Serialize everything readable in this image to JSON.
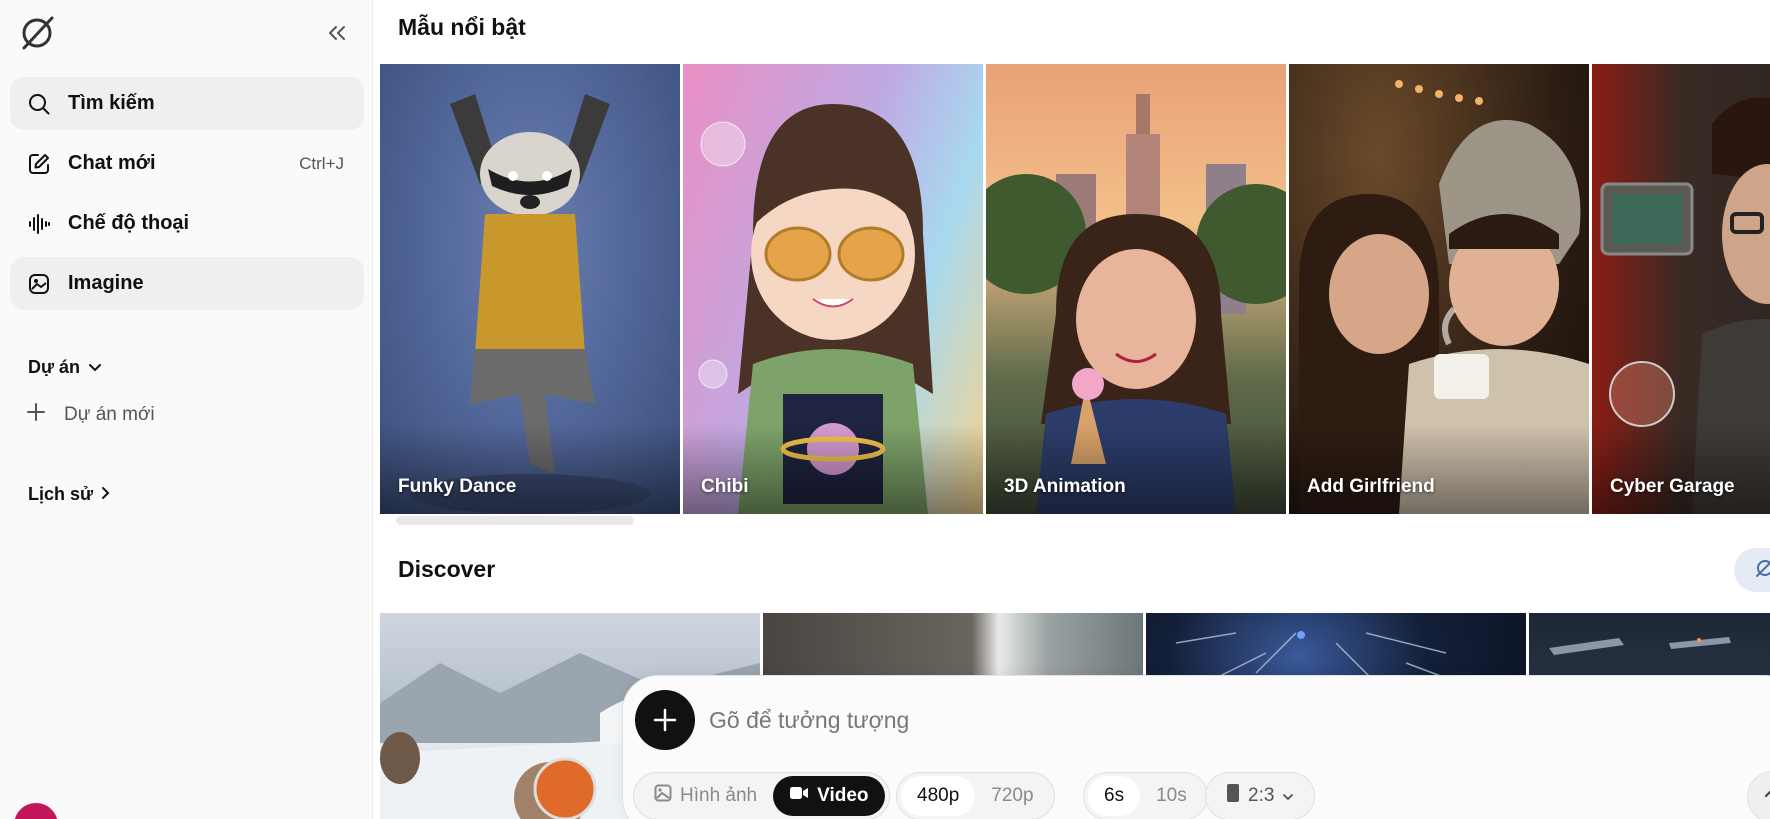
{
  "sidebar": {
    "items": [
      {
        "label": "Tìm kiếm"
      },
      {
        "label": "Chat mới",
        "shortcut": "Ctrl+J"
      },
      {
        "label": "Chế độ thoại"
      },
      {
        "label": "Imagine"
      }
    ],
    "projects_label": "Dự án",
    "new_project_label": "Dự án mới",
    "history_label": "Lịch sử"
  },
  "main": {
    "featured_title": "Mẫu nổi bật",
    "featured": [
      {
        "label": "Funky Dance"
      },
      {
        "label": "Chibi"
      },
      {
        "label": "3D Animation"
      },
      {
        "label": "Add Girlfriend"
      },
      {
        "label": "Cyber Garage"
      }
    ],
    "discover_title": "Discover"
  },
  "composer": {
    "placeholder": "Gõ để tưởng tượng",
    "mode": {
      "image_label": "Hình ảnh",
      "video_label": "Video",
      "selected": "Video"
    },
    "resolution": {
      "options": [
        "480p",
        "720p"
      ],
      "selected": "480p"
    },
    "duration": {
      "options": [
        "6s",
        "10s"
      ],
      "selected": "6s"
    },
    "aspect": {
      "value": "2:3"
    }
  },
  "colors": {
    "accent_dark": "#111111",
    "active_bg": "#efefef",
    "discover_btn": "#e4ebf7",
    "avatar": "#c2185b"
  }
}
